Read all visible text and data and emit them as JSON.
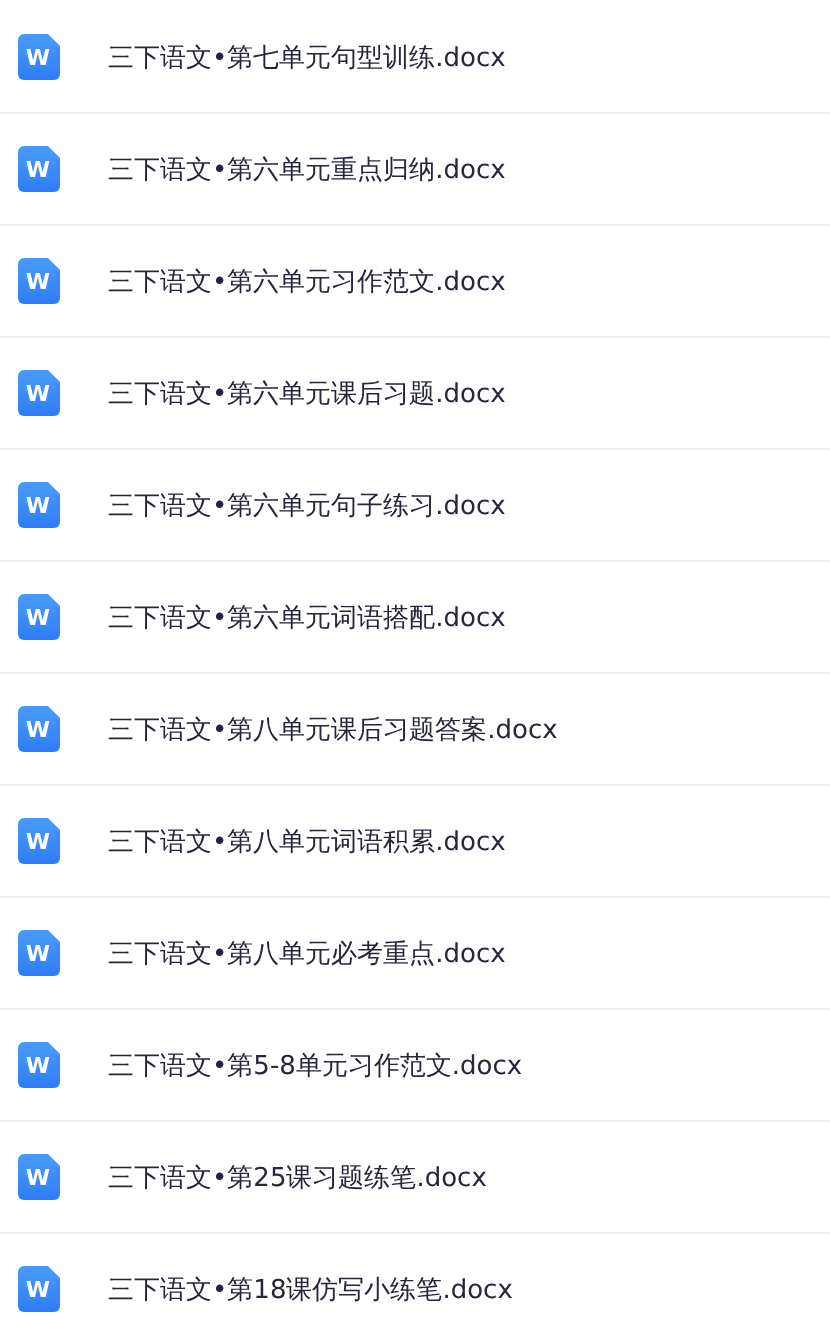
{
  "files": [
    {
      "name": "三下语文•第七单元句型训练.docx",
      "icon_label": "W"
    },
    {
      "name": "三下语文•第六单元重点归纳.docx",
      "icon_label": "W"
    },
    {
      "name": "三下语文•第六单元习作范文.docx",
      "icon_label": "W"
    },
    {
      "name": "三下语文•第六单元课后习题.docx",
      "icon_label": "W"
    },
    {
      "name": "三下语文•第六单元句子练习.docx",
      "icon_label": "W"
    },
    {
      "name": "三下语文•第六单元词语搭配.docx",
      "icon_label": "W"
    },
    {
      "name": "三下语文•第八单元课后习题答案.docx",
      "icon_label": "W"
    },
    {
      "name": "三下语文•第八单元词语积累.docx",
      "icon_label": "W"
    },
    {
      "name": "三下语文•第八单元必考重点.docx",
      "icon_label": "W"
    },
    {
      "name": "三下语文•第5-8单元习作范文.docx",
      "icon_label": "W"
    },
    {
      "name": "三下语文•第25课习题练笔.docx",
      "icon_label": "W"
    },
    {
      "name": "三下语文•第18课仿写小练笔.docx",
      "icon_label": "W"
    }
  ]
}
